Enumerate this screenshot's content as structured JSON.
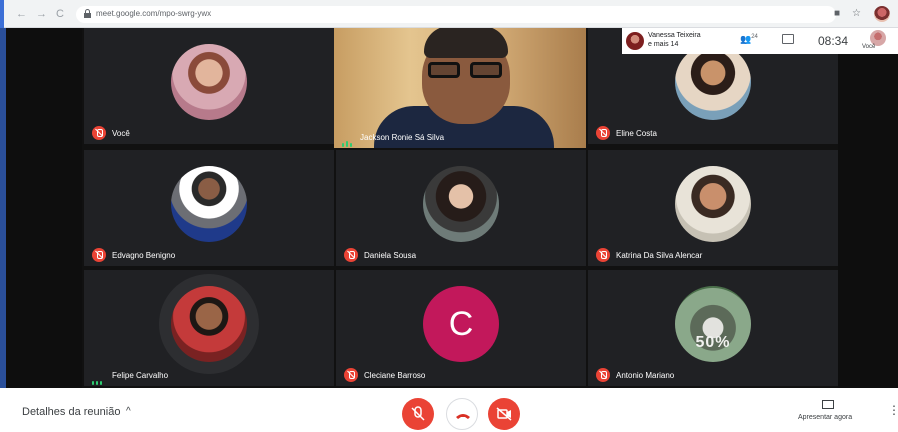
{
  "browser": {
    "url": "meet.google.com/mpo-swrg-ywx",
    "back": "←",
    "forward": "→",
    "reload": "C",
    "star": "☆"
  },
  "overlay": {
    "presenter_line1": "Vanessa Teixeira",
    "presenter_line2": "e mais 14",
    "people_count": "24",
    "time": "08:34",
    "you_label": "Você"
  },
  "participants": [
    {
      "name": "Você",
      "status": "muted"
    },
    {
      "name": "Jackson Ronie Sá Silva",
      "status": "speaking"
    },
    {
      "name": "Eline Costa",
      "status": "muted"
    },
    {
      "name": "Edvagno Benigno",
      "status": "muted"
    },
    {
      "name": "Daniela Sousa",
      "status": "muted"
    },
    {
      "name": "Katrina Da Silva Alencar",
      "status": "muted"
    },
    {
      "name": "Felipe Carvalho",
      "status": "speaking"
    },
    {
      "name": "Cleciane Barroso",
      "status": "muted",
      "initial": "C"
    },
    {
      "name": "Antonio Mariano",
      "status": "muted",
      "badge": "50%"
    }
  ],
  "bottom": {
    "details_label": "Detalhes da reunião",
    "caret": "^",
    "present_label": "Apresentar agora",
    "more": "⋮"
  },
  "colors": {
    "muted_red": "#ea4335",
    "tile_bg": "#202124",
    "letter_avatar": "#c2185b"
  }
}
